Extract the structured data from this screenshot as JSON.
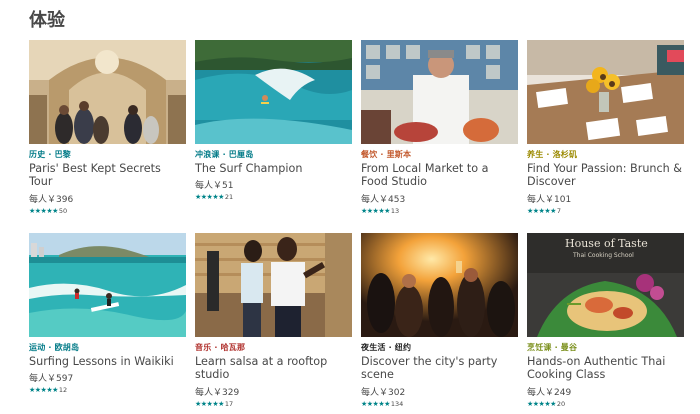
{
  "section": {
    "title": "体验"
  },
  "accent": {
    "teal": "#008489",
    "orange": "#c2582c",
    "olive": "#9b8a00",
    "red": "#b0302c",
    "blue": "#007a87",
    "lime": "#7a8f1a"
  },
  "cards": [
    {
      "category": "历史 · 巴黎",
      "title": "Paris' Best Kept Secrets Tour",
      "price": "每人￥396",
      "stars": "★★★★★",
      "reviews": "50"
    },
    {
      "category": "冲浪课 · 巴厘岛",
      "title": "The Surf Champion",
      "price": "每人￥51",
      "stars": "★★★★★",
      "reviews": "21"
    },
    {
      "category": "餐饮 · 里斯本",
      "title": "From Local Market to a Food Studio",
      "price": "每人￥453",
      "stars": "★★★★★",
      "reviews": "13"
    },
    {
      "category": "养生 · 洛杉矶",
      "title": "Find Your Passion: Brunch & Discover",
      "price": "每人￥101",
      "stars": "★★★★★",
      "reviews": "7"
    },
    {
      "category": "运动 · 欧胡岛",
      "title": "Surfing Lessons in Waikiki",
      "price": "每人￥597",
      "stars": "★★★★★",
      "reviews": "12"
    },
    {
      "category": "音乐 · 哈瓦那",
      "title": "Learn salsa at a rooftop studio",
      "price": "每人￥329",
      "stars": "★★★★★",
      "reviews": "17"
    },
    {
      "category": "夜生活 · 纽约",
      "title": "Discover the city's party scene",
      "price": "每人￥302",
      "stars": "★★★★★",
      "reviews": "134"
    },
    {
      "category": "烹饪课 · 曼谷",
      "title": "Hands-on Authentic Thai Cooking Class",
      "price": "每人￥249",
      "stars": "★★★★★",
      "reviews": "20"
    }
  ],
  "image_text": {
    "thai_sign_1": "House of Taste",
    "thai_sign_2": "Thai Cooking School"
  }
}
